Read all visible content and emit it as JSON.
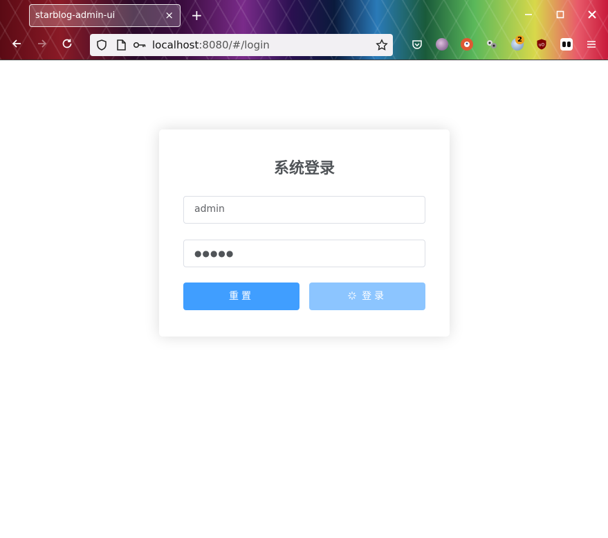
{
  "browser": {
    "tab_title": "starblog-admin-ui",
    "tab_close": "×",
    "new_tab": "+",
    "url_host": "localhost",
    "url_rest": ":8080/#/login",
    "extension_badge": "2",
    "icons": [
      "back-arrow-icon",
      "forward-arrow-icon",
      "reload-icon",
      "shield-icon",
      "page-icon",
      "key-icon",
      "star-icon",
      "pocket-icon",
      "extension-icon",
      "duckduckgo-icon",
      "ublock-icon",
      "menu-icon"
    ]
  },
  "login": {
    "title": "系统登录",
    "username_value": "admin",
    "password_value": "●●●●●",
    "reset_label": "重置",
    "login_label": "登录",
    "login_loading_icon": "spinner-icon"
  },
  "colors": {
    "primary": "#409eff",
    "primary_disabled": "#8cc5ff",
    "title": "#505458"
  }
}
